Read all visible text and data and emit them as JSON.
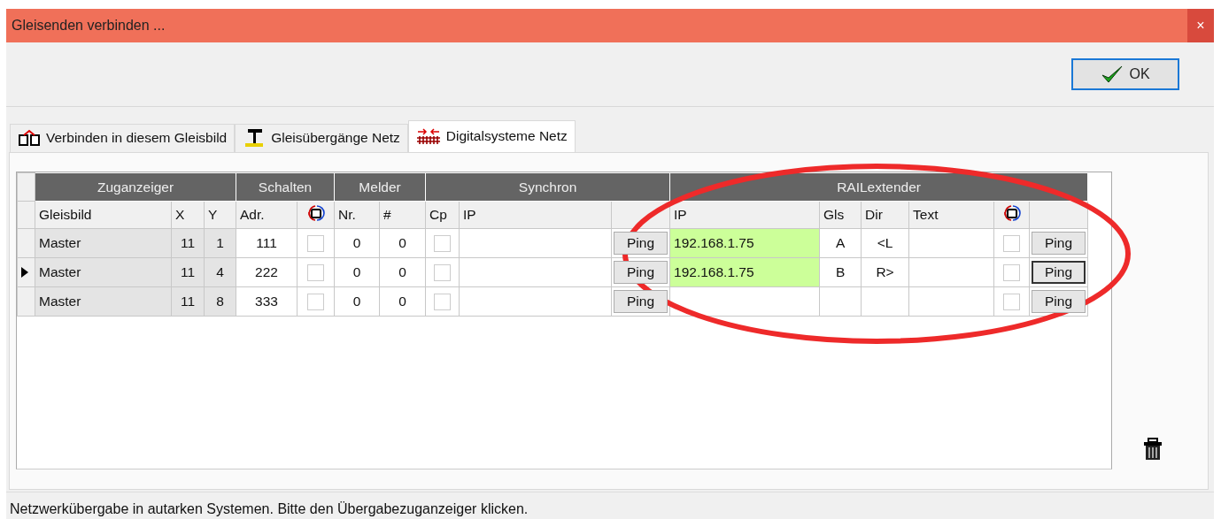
{
  "window": {
    "title": "Gleisenden verbinden ...",
    "close": "×"
  },
  "toolbar": {
    "ok_button": "OK"
  },
  "tabs": [
    {
      "label": "Verbinden in diesem Gleisbild",
      "selected": false
    },
    {
      "label": "Gleisübergänge Netz",
      "selected": false
    },
    {
      "label": "Digitalsysteme Netz",
      "selected": true
    }
  ],
  "table": {
    "groups": [
      {
        "label": "Zuganzeiger"
      },
      {
        "label": "Schalten"
      },
      {
        "label": "Melder"
      },
      {
        "label": "Synchron"
      },
      {
        "label": "RAILextender"
      }
    ],
    "columns": [
      {
        "kind": "text",
        "label": "Gleisbild"
      },
      {
        "kind": "text",
        "label": "X"
      },
      {
        "kind": "text",
        "label": "Y"
      },
      {
        "kind": "text",
        "label": "Adr."
      },
      {
        "kind": "sync"
      },
      {
        "kind": "text",
        "label": "Nr."
      },
      {
        "kind": "text",
        "label": "#"
      },
      {
        "kind": "text",
        "label": "Cp"
      },
      {
        "kind": "text",
        "label": "IP"
      },
      {
        "kind": "blank"
      },
      {
        "kind": "text",
        "label": "IP"
      },
      {
        "kind": "text",
        "label": "Gls"
      },
      {
        "kind": "text",
        "label": "Dir"
      },
      {
        "kind": "text",
        "label": "Text"
      },
      {
        "kind": "sync"
      },
      {
        "kind": "blank"
      }
    ],
    "rows": [
      {
        "selected": false,
        "cells": [
          {
            "kind": "fixed",
            "text": "Master"
          },
          {
            "kind": "fixed",
            "text": "11"
          },
          {
            "kind": "fixed",
            "text": "1"
          },
          {
            "kind": "text",
            "text": "111"
          },
          {
            "kind": "check",
            "checked": false
          },
          {
            "kind": "text",
            "text": "0"
          },
          {
            "kind": "text",
            "text": "0"
          },
          {
            "kind": "check",
            "checked": false
          },
          {
            "kind": "text"
          },
          {
            "kind": "button",
            "text": "Ping",
            "focused": false
          },
          {
            "kind": "text",
            "text": "192.168.1.75",
            "highlighted": true
          },
          {
            "kind": "text",
            "text": "A"
          },
          {
            "kind": "text",
            "text": "<L"
          },
          {
            "kind": "text"
          },
          {
            "kind": "check",
            "checked": false
          },
          {
            "kind": "button",
            "text": "Ping",
            "focused": false
          }
        ]
      },
      {
        "selected": true,
        "cells": [
          {
            "kind": "fixed",
            "text": "Master"
          },
          {
            "kind": "fixed",
            "text": "11"
          },
          {
            "kind": "fixed",
            "text": "4"
          },
          {
            "kind": "text",
            "text": "222"
          },
          {
            "kind": "check",
            "checked": false
          },
          {
            "kind": "text",
            "text": "0"
          },
          {
            "kind": "text",
            "text": "0"
          },
          {
            "kind": "check",
            "checked": false
          },
          {
            "kind": "text"
          },
          {
            "kind": "button",
            "text": "Ping",
            "focused": false
          },
          {
            "kind": "text",
            "text": "192.168.1.75",
            "highlighted": true
          },
          {
            "kind": "text",
            "text": "B"
          },
          {
            "kind": "text",
            "text": "R>"
          },
          {
            "kind": "text"
          },
          {
            "kind": "check",
            "checked": false
          },
          {
            "kind": "button",
            "text": "Ping",
            "focused": true
          }
        ]
      },
      {
        "selected": false,
        "cells": [
          {
            "kind": "fixed",
            "text": "Master"
          },
          {
            "kind": "fixed",
            "text": "11"
          },
          {
            "kind": "fixed",
            "text": "8"
          },
          {
            "kind": "text",
            "text": "333"
          },
          {
            "kind": "check",
            "checked": false
          },
          {
            "kind": "text",
            "text": "0"
          },
          {
            "kind": "text",
            "text": "0"
          },
          {
            "kind": "check",
            "checked": false
          },
          {
            "kind": "text"
          },
          {
            "kind": "button",
            "text": "Ping",
            "focused": false
          },
          {
            "kind": "text",
            "highlighted": false
          },
          {
            "kind": "text"
          },
          {
            "kind": "text"
          },
          {
            "kind": "text"
          },
          {
            "kind": "check",
            "checked": false
          },
          {
            "kind": "button",
            "text": "Ping",
            "focused": false
          }
        ]
      }
    ]
  },
  "annotation": {
    "kind": "ellipse"
  },
  "status_bar": {
    "text": "Netzwerkübergabe in autarken Systemen. Bitte den Übergabezuganzeiger klicken."
  }
}
